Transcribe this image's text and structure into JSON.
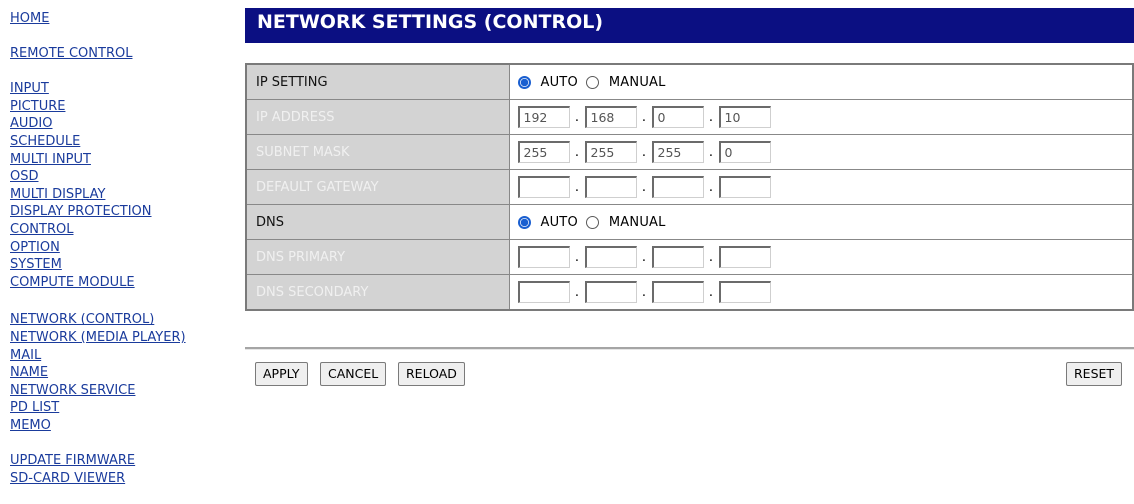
{
  "nav": {
    "groups": [
      [
        "HOME"
      ],
      [
        "REMOTE CONTROL"
      ],
      [
        "INPUT",
        "PICTURE",
        "AUDIO",
        "SCHEDULE",
        "MULTI INPUT",
        "OSD",
        "MULTI DISPLAY",
        "DISPLAY PROTECTION",
        "CONTROL",
        "OPTION",
        "SYSTEM",
        "COMPUTE MODULE"
      ],
      [
        "NETWORK (CONTROL)",
        "NETWORK (MEDIA PLAYER)",
        "MAIL",
        "NAME",
        "NETWORK SERVICE",
        "PD LIST",
        "MEMO"
      ],
      [
        "UPDATE FIRMWARE",
        "SD-CARD VIEWER"
      ]
    ]
  },
  "page": {
    "title": "NETWORK SETTINGS (CONTROL)"
  },
  "rows": {
    "ip_setting": {
      "label": "IP SETTING",
      "auto": "AUTO",
      "manual": "MANUAL",
      "selected": "AUTO"
    },
    "ip_address": {
      "label": "IP ADDRESS",
      "octets": [
        "192",
        "168",
        "0",
        "10"
      ]
    },
    "subnet_mask": {
      "label": "SUBNET MASK",
      "octets": [
        "255",
        "255",
        "255",
        "0"
      ]
    },
    "default_gateway": {
      "label": "DEFAULT GATEWAY",
      "octets": [
        "",
        "",
        "",
        ""
      ]
    },
    "dns": {
      "label": "DNS",
      "auto": "AUTO",
      "manual": "MANUAL",
      "selected": "AUTO"
    },
    "dns_primary": {
      "label": "DNS PRIMARY",
      "octets": [
        "",
        "",
        "",
        ""
      ]
    },
    "dns_secondary": {
      "label": "DNS SECONDARY",
      "octets": [
        "",
        "",
        "",
        ""
      ]
    }
  },
  "separator": ".",
  "buttons": {
    "apply": "APPLY",
    "cancel": "CANCEL",
    "reload": "RELOAD",
    "reset": "RESET"
  },
  "colors": {
    "title_bar": "#0b0f82",
    "link": "#1a3b9c",
    "label_bg": "#d3d3d3",
    "radio_accent": "#1a5fd0"
  }
}
